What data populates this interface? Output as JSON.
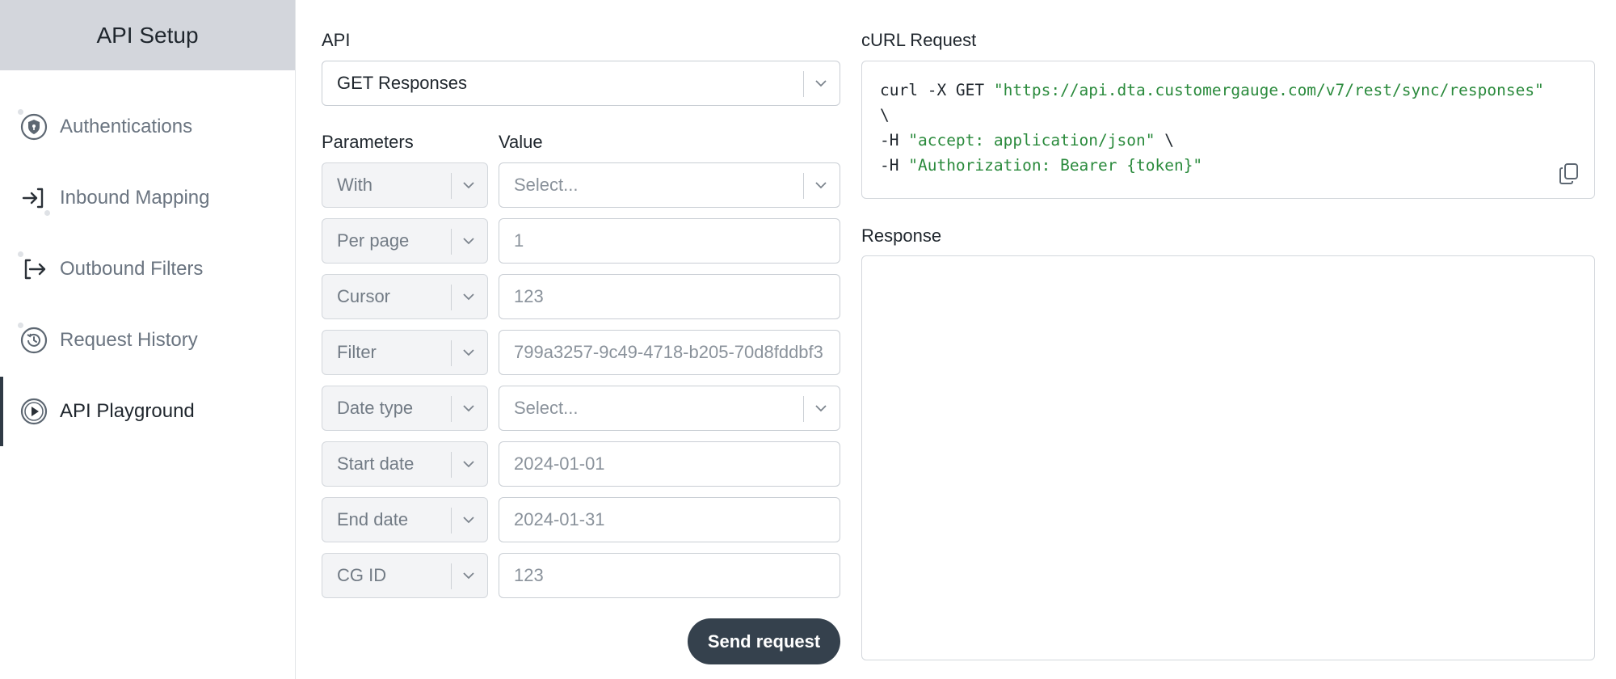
{
  "sidebar": {
    "title": "API Setup",
    "items": [
      {
        "label": "Authentications",
        "icon": "shield-icon"
      },
      {
        "label": "Inbound Mapping",
        "icon": "arrow-into-bracket-icon"
      },
      {
        "label": "Outbound Filters",
        "icon": "arrow-out-of-bracket-icon"
      },
      {
        "label": "Request History",
        "icon": "history-clock-icon"
      },
      {
        "label": "API Playground",
        "icon": "play-circle-icon",
        "active": true
      }
    ]
  },
  "form": {
    "api_label": "API",
    "api_value": "GET Responses",
    "parameters_label": "Parameters",
    "value_label": "Value",
    "rows": [
      {
        "param": "With",
        "value": "Select...",
        "type": "select"
      },
      {
        "param": "Per page",
        "value": "1",
        "type": "input"
      },
      {
        "param": "Cursor",
        "value": "123",
        "type": "input"
      },
      {
        "param": "Filter",
        "value": "799a3257-9c49-4718-b205-70d8fddbf3(",
        "type": "input"
      },
      {
        "param": "Date type",
        "value": "Select...",
        "type": "select"
      },
      {
        "param": "Start date",
        "value": "2024-01-01",
        "type": "input"
      },
      {
        "param": "End date",
        "value": "2024-01-31",
        "type": "input"
      },
      {
        "param": "CG ID",
        "value": "123",
        "type": "input"
      }
    ],
    "send_label": "Send request"
  },
  "curl": {
    "label": "cURL Request",
    "l1_cmd": "curl -X GET ",
    "l1_url": "\"https://api.dta.customergauge.com/v7/rest/sync/responses\"",
    "l2": "\\",
    "l3_cmd": "-H ",
    "l3_str": "\"accept: application/json\"",
    "l3_tail": " \\",
    "l4_cmd": "-H ",
    "l4_str": "\"Authorization: Bearer {token}\""
  },
  "response": {
    "label": "Response"
  },
  "colors": {
    "sidebar_header_bg": "#d3d6dc",
    "button_bg": "#35414d",
    "curl_string": "#2a8a3c"
  }
}
